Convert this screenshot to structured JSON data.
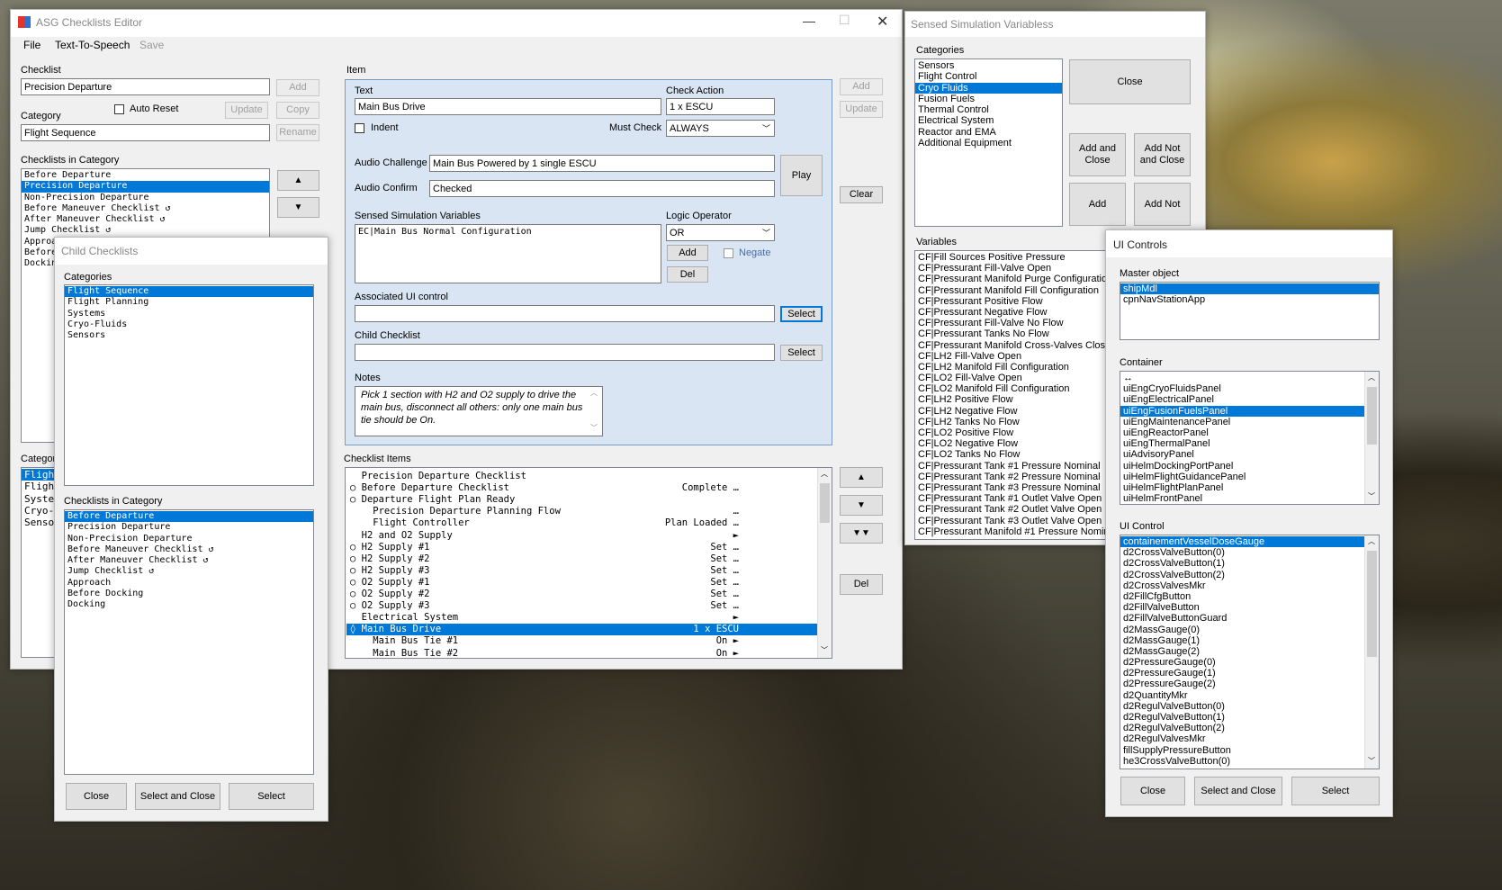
{
  "main": {
    "title": "ASG Checklists Editor",
    "menu": [
      "File",
      "Text-To-Speech",
      "Save"
    ],
    "checklist_label": "Checklist",
    "checklist_value": "Precision Departure",
    "add": "Add",
    "auto_reset": "Auto Reset",
    "update": "Update",
    "copy": "Copy",
    "category_label": "Category",
    "category_value": "Flight Sequence",
    "rename": "Rename",
    "checklists_in_category_label": "Checklists in Category",
    "checklists_in_category": [
      "Before Departure",
      "Precision Departure",
      "Non-Precision Departure",
      "Before Maneuver Checklist ↺",
      "After Maneuver Checklist ↺",
      "Jump Checklist ↺",
      "Approa",
      "Before",
      "Dockin"
    ],
    "up": "▲",
    "down": "▼",
    "categories_label_partial": "Categori",
    "categories_partial": [
      "Fligh",
      "Fligh",
      "Syste",
      "Cryo-",
      "Senso"
    ],
    "item": {
      "label": "Item",
      "text_label": "Text",
      "text_value": "Main Bus Drive",
      "check_action_label": "Check Action",
      "check_action_value": "1 x ESCU",
      "indent": "Indent",
      "must_check_label": "Must Check",
      "must_check_value": "ALWAYS",
      "audio_challenge_label": "Audio Challenge",
      "audio_challenge_value": "Main Bus Powered by 1 single ESCU",
      "audio_confirm_label": "Audio Confirm",
      "audio_confirm_value": "Checked",
      "play": "Play",
      "sensed_label": "Sensed Simulation Variables",
      "sensed_value": "EC|Main Bus Normal Configuration",
      "logic_label": "Logic Operator",
      "logic_value": "OR",
      "add": "Add",
      "negate": "Negate",
      "del": "Del",
      "assoc_label": "Associated UI control",
      "select": "Select",
      "child_label": "Child Checklist",
      "notes_label": "Notes",
      "notes_value": "Pick 1 section with H2 and O2 supply to drive the main bus, disconnect all others: only one main bus tie should be On."
    },
    "right_add": "Add",
    "right_update": "Update",
    "clear": "Clear",
    "checklist_items_label": "Checklist Items",
    "checklist_items": [
      {
        "text": "  Precision Departure Checklist",
        "action": ""
      },
      {
        "text": "○ Before Departure Checklist",
        "action": "Complete …"
      },
      {
        "text": "○ Departure Flight Plan Ready",
        "action": ""
      },
      {
        "text": "    Precision Departure Planning Flow",
        "action": "…"
      },
      {
        "text": "    Flight Controller",
        "action": "Plan Loaded …"
      },
      {
        "text": "  H2 and O2 Supply",
        "action": "►"
      },
      {
        "text": "○ H2 Supply #1",
        "action": "Set …"
      },
      {
        "text": "○ H2 Supply #2",
        "action": "Set …"
      },
      {
        "text": "○ H2 Supply #3",
        "action": "Set …"
      },
      {
        "text": "○ O2 Supply #1",
        "action": "Set …"
      },
      {
        "text": "○ O2 Supply #2",
        "action": "Set …"
      },
      {
        "text": "○ O2 Supply #3",
        "action": "Set …"
      },
      {
        "text": "  Electrical System",
        "action": "►"
      },
      {
        "text": "◊ Main Bus Drive",
        "action": "1 x ESCU"
      },
      {
        "text": "    Main Bus Tie #1",
        "action": "On ►"
      },
      {
        "text": "    Main Bus Tie #2",
        "action": "On ►"
      }
    ],
    "item_up": "▲",
    "item_down": "▼",
    "item_bottom": "▼▼",
    "del": "Del"
  },
  "child": {
    "title": "Child Checklists",
    "categories_label": "Categories",
    "categories": [
      "Flight Sequence",
      "Flight Planning",
      "Systems",
      "Cryo-Fluids",
      "Sensors"
    ],
    "checklists_label": "Checklists in Category",
    "checklists": [
      "Before Departure",
      "Precision Departure",
      "Non-Precision Departure",
      "Before Maneuver Checklist ↺",
      "After Maneuver Checklist ↺",
      "Jump Checklist ↺",
      "Approach",
      "Before Docking",
      "Docking"
    ],
    "close": "Close",
    "select_close": "Select and Close",
    "select": "Select"
  },
  "sensed": {
    "title": "Sensed Simulation Variabless",
    "categories_label": "Categories",
    "categories": [
      "Sensors",
      "Flight Control",
      "Cryo Fluids",
      "Fusion Fuels",
      "Thermal Control",
      "Electrical System",
      "Reactor and EMA",
      "Additional Equipment"
    ],
    "close": "Close",
    "add_close": "Add and Close",
    "add_not_close": "Add Not and Close",
    "add": "Add",
    "add_not": "Add Not",
    "variables_label": "Variables",
    "variables": [
      "CF|Fill Sources Positive Pressure",
      "CF|Pressurant Fill-Valve Open",
      "CF|Pressurant Manifold Purge Configuration",
      "CF|Pressurant Manifold Fill Configuration",
      "CF|Pressurant Positive Flow",
      "CF|Pressurant Negative Flow",
      "CF|Pressurant Fill-Valve No Flow",
      "CF|Pressurant Tanks No Flow",
      "CF|Pressurant Manifold Cross-Valves Closed",
      "CF|LH2 Fill-Valve Open",
      "CF|LH2 Manifold Fill Configuration",
      "CF|LO2 Fill-Valve Open",
      "CF|LO2 Manifold Fill Configuration",
      "CF|LH2 Positive Flow",
      "CF|LH2 Negative Flow",
      "CF|LH2 Tanks No Flow",
      "CF|LO2 Positive Flow",
      "CF|LO2 Negative Flow",
      "CF|LO2 Tanks No Flow",
      "CF|Pressurant Tank #1 Pressure Nominal",
      "CF|Pressurant Tank #2 Pressure Nominal",
      "CF|Pressurant Tank #3 Pressure Nominal",
      "CF|Pressurant Tank #1 Outlet Valve Open",
      "CF|Pressurant Tank #2 Outlet Valve Open",
      "CF|Pressurant Tank #3 Outlet Valve Open",
      "CF|Pressurant Manifold #1 Pressure Nominal"
    ]
  },
  "ui": {
    "title": "UI Controls",
    "master_label": "Master object",
    "master": [
      "shipMdl",
      "cpnNavStationApp"
    ],
    "container_label": "Container",
    "container": [
      "↔",
      "uiEngCryoFluidsPanel",
      "uiEngElectricalPanel",
      "uiEngFusionFuelsPanel",
      "uiEngMaintenancePanel",
      "uiEngReactorPanel",
      "uiEngThermalPanel",
      "uiAdvisoryPanel",
      "uiHelmDockingPortPanel",
      "uiHelmFlightGuidancePanel",
      "uiHelmFlightPlanPanel",
      "uiHelmFrontPanel"
    ],
    "control_label": "UI Control",
    "controls": [
      "containementVesselDoseGauge",
      "d2CrossValveButton(0)",
      "d2CrossValveButton(1)",
      "d2CrossValveButton(2)",
      "d2CrossValvesMkr",
      "d2FillCfgButton",
      "d2FillValveButton",
      "d2FillValveButtonGuard",
      "d2MassGauge(0)",
      "d2MassGauge(1)",
      "d2MassGauge(2)",
      "d2PressureGauge(0)",
      "d2PressureGauge(1)",
      "d2PressureGauge(2)",
      "d2QuantityMkr",
      "d2RegulValveButton(0)",
      "d2RegulValveButton(1)",
      "d2RegulValveButton(2)",
      "d2RegulValvesMkr",
      "fillSupplyPressureButton",
      "he3CrossValveButton(0)"
    ],
    "close": "Close",
    "select_close": "Select and Close",
    "select": "Select"
  },
  "colors": {
    "selection": "#0078d7",
    "item_panel": "#d9e5f3"
  }
}
